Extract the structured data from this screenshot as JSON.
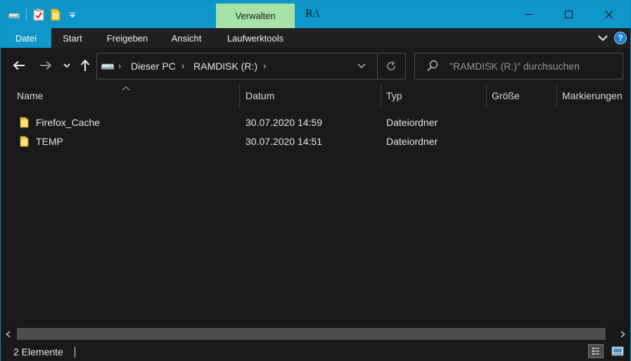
{
  "window": {
    "context_tab": "Verwalten",
    "title": "R:\\"
  },
  "ribbon": {
    "tabs": [
      {
        "label": "Datei",
        "active": true
      },
      {
        "label": "Start"
      },
      {
        "label": "Freigeben"
      },
      {
        "label": "Ansicht"
      },
      {
        "label": "Laufwerktools"
      }
    ],
    "help_label": "?"
  },
  "address": {
    "crumbs": [
      "Dieser PC",
      "RAMDISK (R:)"
    ]
  },
  "search": {
    "placeholder": "\"RAMDISK (R:)\" durchsuchen"
  },
  "columns": {
    "name": "Name",
    "date": "Datum",
    "type": "Typ",
    "size": "Größe",
    "tags": "Markierungen"
  },
  "files": [
    {
      "name": "Firefox_Cache",
      "date": "30.07.2020 14:59",
      "type": "Dateiordner",
      "size": ""
    },
    {
      "name": "TEMP",
      "date": "30.07.2020 14:51",
      "type": "Dateiordner",
      "size": ""
    }
  ],
  "status": {
    "count": "2 Elemente"
  },
  "colors": {
    "accent": "#0e96c8",
    "context_tab": "#a6e1a6",
    "background": "#191919",
    "folder": "#f5c842"
  }
}
